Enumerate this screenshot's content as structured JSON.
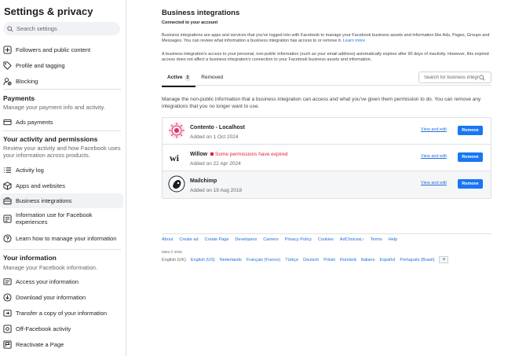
{
  "sidebar": {
    "title": "Settings & privacy",
    "search_placeholder": "Search settings",
    "items_top": [
      {
        "label": "Followers and public content"
      },
      {
        "label": "Profile and tagging"
      },
      {
        "label": "Blocking"
      }
    ],
    "payments": {
      "heading": "Payments",
      "sub": "Manage your payment info and activity.",
      "items": [
        {
          "label": "Ads payments"
        }
      ]
    },
    "activity": {
      "heading": "Your activity and permissions",
      "sub": "Review your activity and how Facebook uses your information across products.",
      "items": [
        {
          "label": "Activity log"
        },
        {
          "label": "Apps and websites"
        },
        {
          "label": "Business integrations"
        },
        {
          "label": "Information use for Facebook experiences"
        },
        {
          "label": "Learn how to manage your information"
        }
      ]
    },
    "info": {
      "heading": "Your information",
      "sub": "Manage your Facebook information.",
      "items": [
        {
          "label": "Access your information"
        },
        {
          "label": "Download your information"
        },
        {
          "label": "Transfer a copy of your information"
        },
        {
          "label": "Off-Facebook activity"
        },
        {
          "label": "Reactivate a Page"
        }
      ]
    }
  },
  "main": {
    "title": "Business integrations",
    "subtitle": "Connected to your account",
    "desc1": "Business integrations are apps and services that you've logged into with Facebook to manage your Facebook business assets and information like Ads, Pages, Groups and Messages. You can review what information a business integration has access to or remove it.",
    "learn_more": "Learn more",
    "desc2": "A business integration's access to your personal, non-public information (such as your email address) automatically expires after 90 days of inactivity. However, this expired access does not affect a business integration's connection to your Facebook business assets and information.",
    "tabs": [
      {
        "label": "Active",
        "badge": "3"
      },
      {
        "label": "Removed"
      }
    ],
    "search_placeholder": "Search for business integrations",
    "manage_text": "Manage the non-public information that a business integration can access and what you've given them permission to do. You can remove any integrations that you no longer want to use.",
    "integrations": [
      {
        "name": "Contento - Localhost",
        "date": "Added on 1 Oct 2024",
        "warning": "",
        "view": "View and edit",
        "remove": "Remove"
      },
      {
        "name": "Willow",
        "date": "Added on 22 Apr 2024",
        "warning": "Some permissions have expired",
        "view": "View and edit",
        "remove": "Remove"
      },
      {
        "name": "Mailchimp",
        "date": "Added on 19 Aug 2018",
        "warning": "",
        "view": "View and edit",
        "remove": "Remove"
      }
    ]
  },
  "footer": {
    "links": [
      "About",
      "Create ad",
      "Create Page",
      "Developers",
      "Careers",
      "Privacy Policy",
      "Cookies",
      "AdChoices",
      "Terms",
      "Help"
    ],
    "copyright": "Meta © 2025",
    "current_lang": "English (UK)",
    "langs": [
      "English (US)",
      "Nederlands",
      "Français (France)",
      "Türkçe",
      "Deutsch",
      "Polski",
      "Română",
      "Italiano",
      "Español",
      "Português (Brasil)"
    ],
    "more": "+"
  },
  "colors": {
    "accent": "#1877f2",
    "warning": "#e41e3f"
  }
}
